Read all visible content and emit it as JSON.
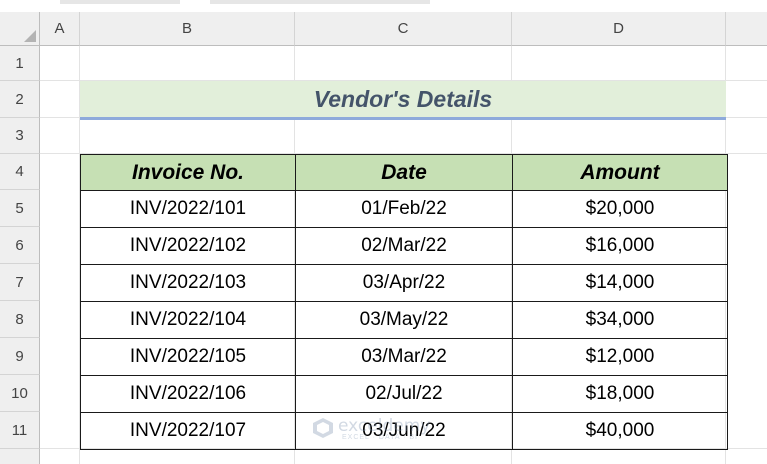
{
  "sheet": {
    "columns": [
      "A",
      "B",
      "C",
      "D"
    ],
    "rows": [
      "1",
      "2",
      "3",
      "4",
      "5",
      "6",
      "7",
      "8",
      "9",
      "10",
      "11"
    ]
  },
  "title": "Vendor's Details",
  "table": {
    "headers": [
      "Invoice No.",
      "Date",
      "Amount"
    ],
    "rows": [
      [
        "INV/2022/101",
        "01/Feb/22",
        "$20,000"
      ],
      [
        "INV/2022/102",
        "02/Mar/22",
        "$16,000"
      ],
      [
        "INV/2022/103",
        "03/Apr/22",
        "$14,000"
      ],
      [
        "INV/2022/104",
        "03/May/22",
        "$34,000"
      ],
      [
        "INV/2022/105",
        "03/Mar/22",
        "$12,000"
      ],
      [
        "INV/2022/106",
        "02/Jul/22",
        "$18,000"
      ],
      [
        "INV/2022/107",
        "03/Jun/22",
        "$40,000"
      ]
    ]
  },
  "watermark": {
    "name": "exceldemy",
    "tagline": "EXCEL · DATA · BI"
  },
  "colors": {
    "title_bg": "#e2efda",
    "title_text": "#44546a",
    "header_bg": "#c6e0b4",
    "underline": "#8eaadb"
  }
}
